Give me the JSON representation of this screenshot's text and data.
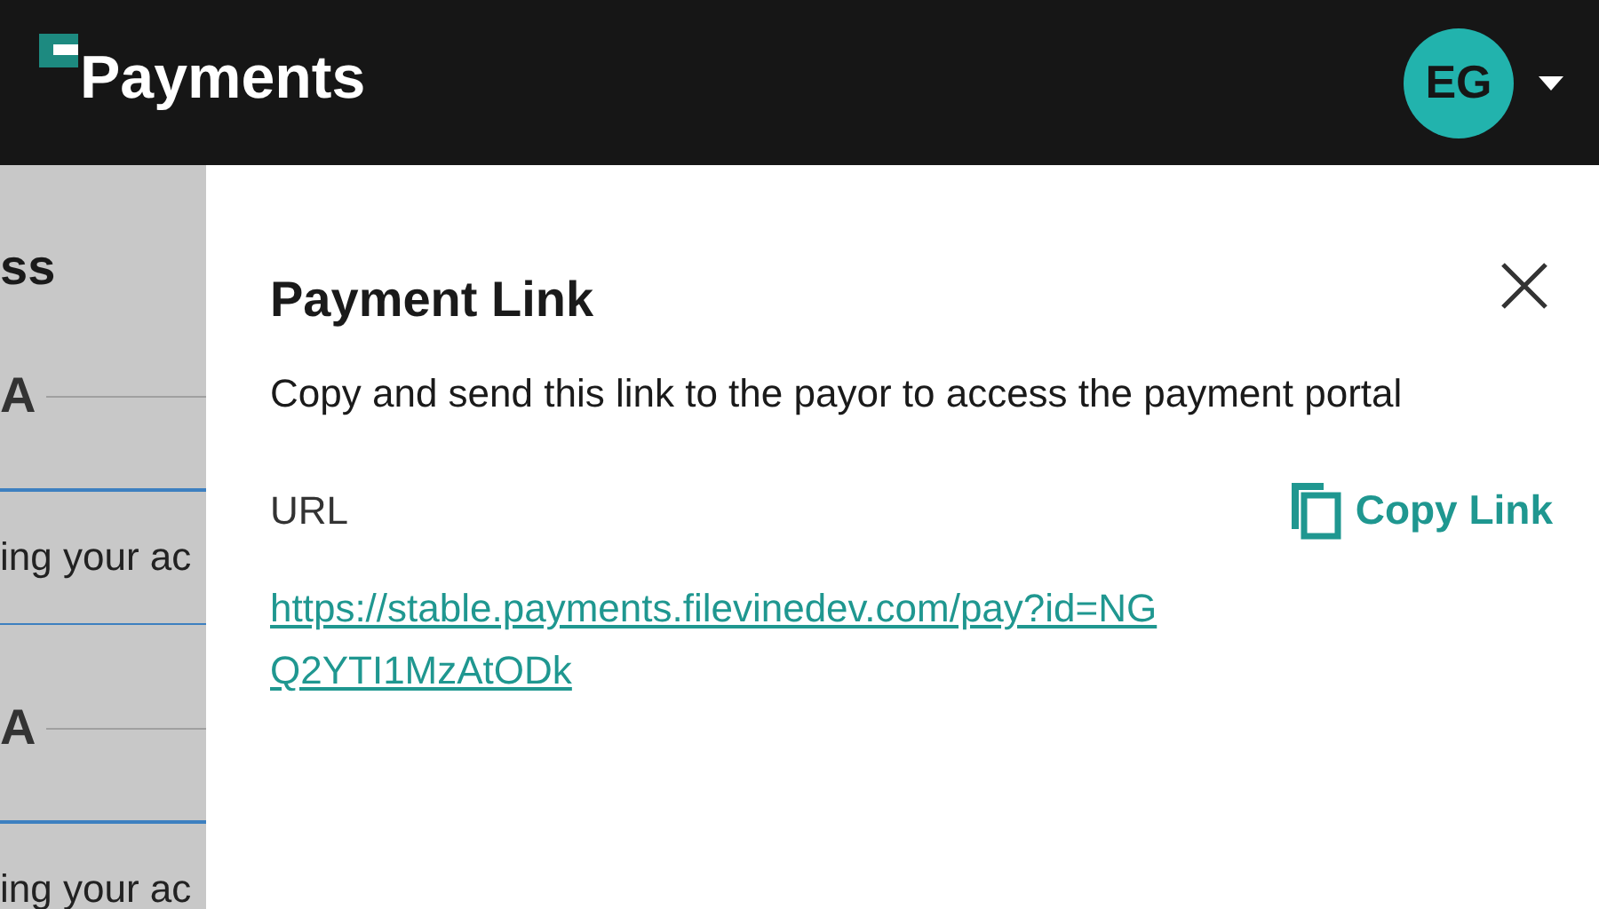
{
  "header": {
    "title": "Payments",
    "avatar_initials": "EG"
  },
  "background": {
    "heading": "ss",
    "sections": [
      {
        "label": "A",
        "text": "ing your ac"
      },
      {
        "label": "A",
        "text": "ing your ac"
      }
    ]
  },
  "dialog": {
    "title": "Payment Link",
    "description": "Copy and send this link to the payor to access the payment portal",
    "url_label": "URL",
    "copy_button": "Copy Link",
    "url": "https://stable.payments.filevinedev.com/pay?id=NGQ2YTI1MzAtODk"
  }
}
